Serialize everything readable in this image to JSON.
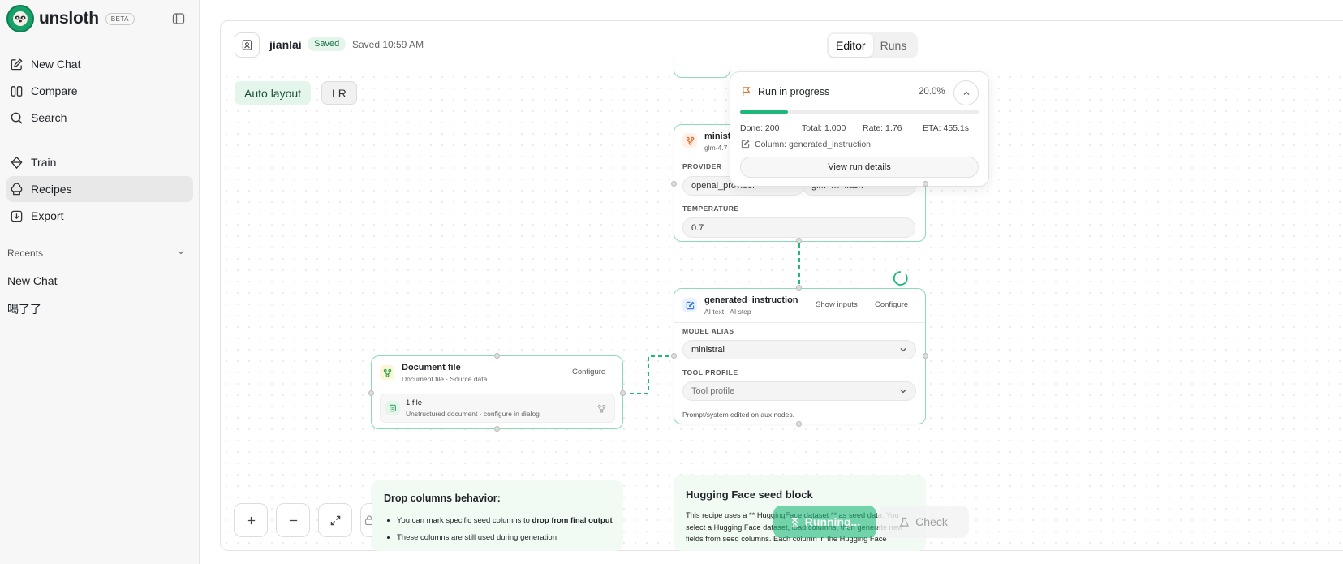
{
  "app": {
    "name": "unsloth",
    "badge": "BETA"
  },
  "sidebar": {
    "items": [
      {
        "label": "New Chat",
        "icon": "edit-icon"
      },
      {
        "label": "Compare",
        "icon": "columns-icon"
      },
      {
        "label": "Search",
        "icon": "search-icon"
      },
      {
        "label": "Train",
        "icon": "diamond-icon"
      },
      {
        "label": "Recipes",
        "icon": "chef-hat-icon",
        "active": true
      },
      {
        "label": "Export",
        "icon": "download-icon"
      }
    ],
    "recents_label": "Recents",
    "recents": [
      "New Chat",
      "喝了了"
    ]
  },
  "header": {
    "project": "jianlai",
    "status_badge": "Saved",
    "saved_time": "Saved 10:59 AM",
    "tabs": [
      "Editor",
      "Runs"
    ],
    "active_tab": "Editor"
  },
  "toolbar": {
    "auto_layout": "Auto layout",
    "direction": "LR"
  },
  "run": {
    "title": "Run in progress",
    "percent_text": "20.0%",
    "progress": 0.2,
    "done": "Done: 200",
    "total": "Total: 1,000",
    "rate": "Rate: 1.76",
    "eta": "ETA: 455.1s",
    "column": "Column: generated_instruction",
    "details_button": "View run details"
  },
  "model_node": {
    "title": "minist",
    "subtitle": "glm-4.7",
    "provider_label": "PROVIDER",
    "provider": "openai_provider",
    "model": "glm-4.7-flash",
    "temperature_label": "TEMPERATURE",
    "temperature": "0.7"
  },
  "gen_node": {
    "title": "generated_instruction",
    "subtitle": "AI text · AI step",
    "show_inputs": "Show inputs",
    "configure": "Configure",
    "model_alias_label": "MODEL ALIAS",
    "model_alias": "ministral",
    "tool_profile_label": "TOOL PROFILE",
    "tool_profile_placeholder": "Tool profile",
    "footer": "Prompt/system edited on aux nodes."
  },
  "doc_node": {
    "title": "Document file",
    "subtitle": "Document file · Source data",
    "configure": "Configure",
    "file_count": "1 file",
    "file_desc": "Unstructured document · configure in dialog"
  },
  "note_drop": {
    "title": "Drop columns behavior:",
    "bullets": [
      {
        "pre": "You can mark specific seed columns to ",
        "bold": "drop from final output"
      },
      {
        "pre": "These columns are still used during generation",
        "bold": ""
      }
    ]
  },
  "note_hf": {
    "title": "Hugging Face seed block",
    "body": "This recipe uses a ** HuggingFace dataset ** as seed data. You select a Hugging Face dataset, load columns, then generate new fields from seed columns. Each column in the Hugging Face"
  },
  "actions": {
    "running": "Running...",
    "check": "Check"
  },
  "colors": {
    "accent": "#16a06a",
    "node_border": "#8fd9b8",
    "progress": "#1fb87a"
  }
}
